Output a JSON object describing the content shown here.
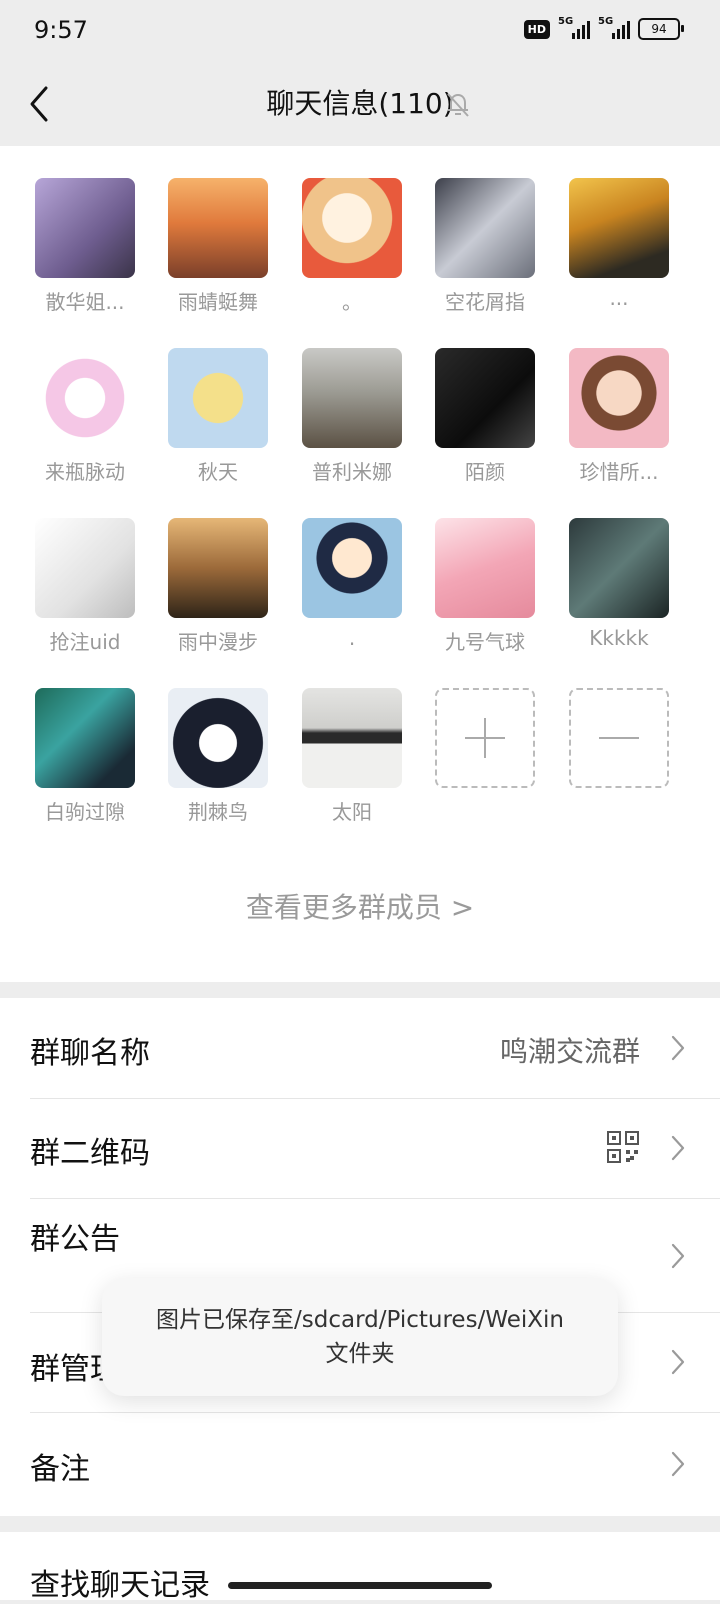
{
  "status_bar": {
    "time": "9:57",
    "hd": "HD",
    "network1": "5G",
    "network2": "5G",
    "battery": "94"
  },
  "header": {
    "title": "聊天信息(110)"
  },
  "members": [
    {
      "name": "散华姐..."
    },
    {
      "name": "雨蜻蜓舞"
    },
    {
      "name": "。"
    },
    {
      "name": "空花屑指"
    },
    {
      "name": "..."
    },
    {
      "name": "来瓶脉动"
    },
    {
      "name": "秋天"
    },
    {
      "name": "普利米娜"
    },
    {
      "name": "陌颜"
    },
    {
      "name": "珍惜所..."
    },
    {
      "name": "抢注uid"
    },
    {
      "name": "雨中漫步"
    },
    {
      "name": "."
    },
    {
      "name": "九号气球"
    },
    {
      "name": "Kkkkk"
    },
    {
      "name": "白驹过隙"
    },
    {
      "name": "荆棘鸟"
    },
    {
      "name": "太阳"
    }
  ],
  "more_members": "查看更多群成员 >",
  "settings": {
    "group_name_label": "群聊名称",
    "group_name_value": "鸣潮交流群",
    "qr_label": "群二维码",
    "notice_label": "群公告",
    "manage_label": "群管理",
    "remark_label": "备注"
  },
  "next_section_label": "查找聊天记录",
  "toast": {
    "line1": "图片已保存至/sdcard/Pictures/WeiXin",
    "line2": "文件夹"
  },
  "icons": {
    "back": "chevron-left-icon",
    "mute": "bell-off-icon",
    "add": "plus-icon",
    "remove": "minus-icon",
    "qr": "qr-code-icon",
    "chevron": "chevron-right-icon"
  }
}
